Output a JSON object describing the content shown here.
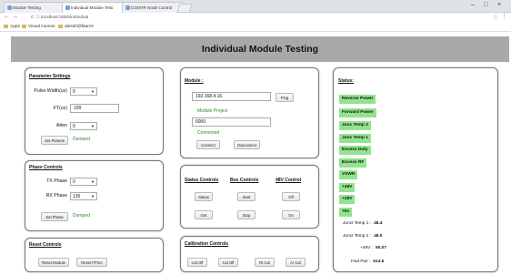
{
  "browser": {
    "tabs": [
      {
        "label": "Module Testing"
      },
      {
        "label": "Individual Module Testi"
      },
      {
        "label": "CGMTR Node Control"
      }
    ],
    "url": "C  ⓘ  localhost:3000/individual",
    "bookmarks": [
      {
        "label": "Apps"
      },
      {
        "label": "Visual Hummi"
      },
      {
        "label": "alessh@blam3"
      }
    ]
  },
  "page": {
    "title": "Individual Module Testing"
  },
  "parameter_settings": {
    "title": "Parameter Settings",
    "pulse_width_label": "Pulse Width(us)",
    "pulse_width_value": "0",
    "ft_label": "FT(us)",
    "ft_value": "100",
    "atten_label": "Atten",
    "atten_value": "0",
    "set_button": "Set Params",
    "status": "Dumped"
  },
  "phase_controls": {
    "title": "Phase Controls",
    "tx_label": "TX Phase",
    "tx_value": "0",
    "rx_label": "RX Phase",
    "rx_value": "135",
    "set_button": "Set Phase",
    "status": "Dumped"
  },
  "reset_controls": {
    "title": "Reset Controls",
    "reset_module": "Reset Module",
    "reset_fpga": "Reset FPGA"
  },
  "module": {
    "title": "Module :",
    "ip_value": "192.168.4.16",
    "ping_button": "Ping",
    "project_label": "Module Project",
    "project_value": "6000",
    "connection_status": "Connected",
    "connect_button": "Connect",
    "disconnect_button": "Disconnect"
  },
  "status_controls": {
    "title": "Status Controls",
    "buttons": [
      "Status",
      "Get"
    ]
  },
  "bus_controls": {
    "title": "Bus Controls",
    "buttons": [
      "Start",
      "Stop"
    ]
  },
  "v48_control": {
    "title": "48V Control",
    "buttons": [
      "Off",
      "On"
    ]
  },
  "calibration_controls": {
    "title": "Calibration Controls",
    "buttons": [
      "Cal Off",
      "Cal Off",
      "Rt Cal",
      "Ar Cal"
    ]
  },
  "status_panel": {
    "title": "Status:",
    "badges": [
      "Reverse Power",
      "Forward Power",
      "Junc Temp 2",
      "Junc Temp 1",
      "Excess Duty",
      "Excess RF",
      "VSWR",
      "+48V",
      "+28V",
      "+5v"
    ],
    "badge_color": "#92e38e",
    "readings": [
      {
        "label": "Junct Temp 1 :",
        "value": "48.4"
      },
      {
        "label": "Junct Temp 2 :",
        "value": "48.0"
      },
      {
        "label": "+48V :",
        "value": "50.07"
      },
      {
        "label": "Fwd Pwr :",
        "value": "614.6"
      }
    ]
  }
}
